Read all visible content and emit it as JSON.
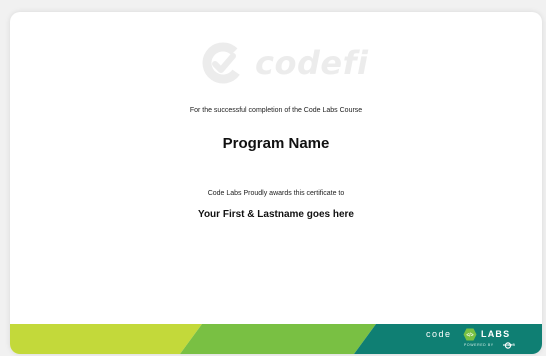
{
  "certificate": {
    "watermark_word": "codefi",
    "completion_text": "For the successful completion of the Code Labs Course",
    "program_name": "Program Name",
    "awards_text": "Code Labs Proudly awards this certificate to",
    "recipient_name": "Your First & Lastname goes here"
  },
  "footer": {
    "brand_code": "code",
    "brand_labs": "LABS",
    "badge_glyph": "</>",
    "powered_by": "POWERED BY",
    "powered_brand": "codefi",
    "colors": {
      "lime": "#c3d93a",
      "green": "#79c043",
      "teal": "#0f7f73"
    }
  },
  "icons": {
    "watermark": "codefi-logo-icon",
    "badge": "code-tag-icon",
    "powered_logo": "codefi-small-logo-icon"
  }
}
